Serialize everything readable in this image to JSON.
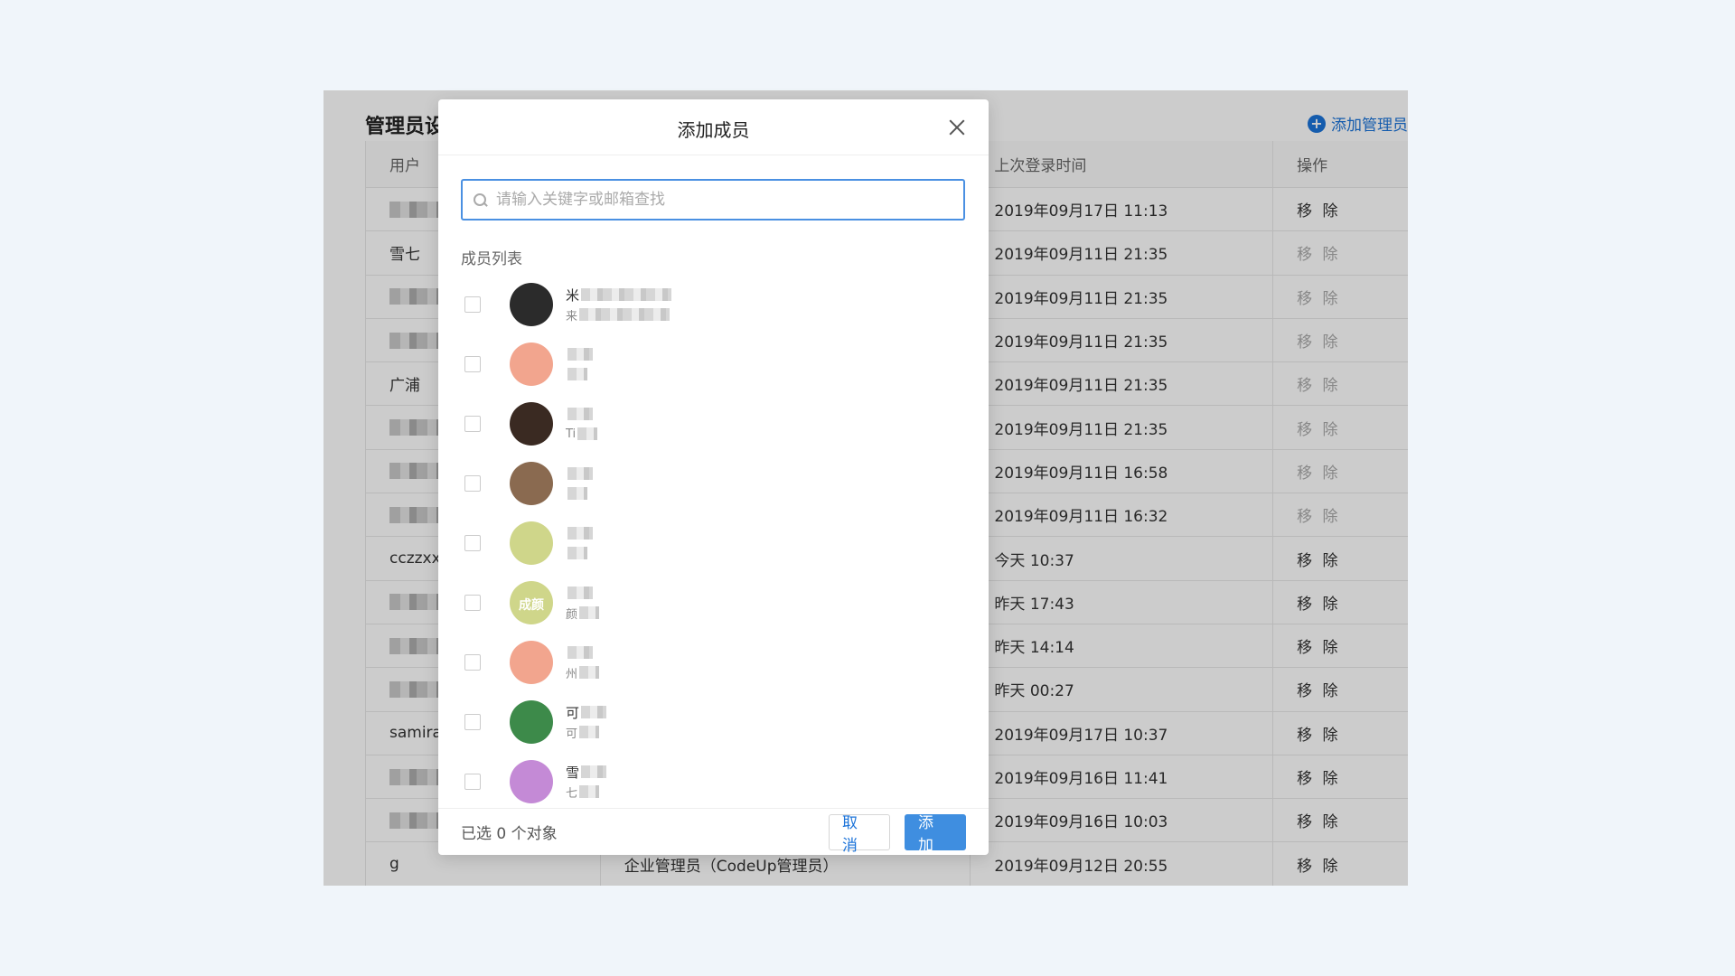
{
  "page": {
    "title": "管理员设",
    "add_admin_label": "添加管理员",
    "table": {
      "headers": {
        "user": "用户",
        "role": "",
        "last_login": "上次登录时间",
        "action": "操作"
      },
      "rows": [
        {
          "user": "",
          "role": "",
          "last_login": "2019年09月17日 11:13",
          "action": "移 除",
          "enabled": true
        },
        {
          "user": "雪七",
          "role": "",
          "last_login": "2019年09月11日 21:35",
          "action": "移 除",
          "enabled": false
        },
        {
          "user": "",
          "role": "",
          "last_login": "2019年09月11日 21:35",
          "action": "移 除",
          "enabled": false
        },
        {
          "user": "",
          "role": "",
          "last_login": "2019年09月11日 21:35",
          "action": "移 除",
          "enabled": false
        },
        {
          "user": "广浦",
          "role": "",
          "last_login": "2019年09月11日 21:35",
          "action": "移 除",
          "enabled": false
        },
        {
          "user": "",
          "role": "",
          "last_login": "2019年09月11日 21:35",
          "action": "移 除",
          "enabled": false
        },
        {
          "user": "",
          "role": "",
          "last_login": "2019年09月11日 16:58",
          "action": "移 除",
          "enabled": false
        },
        {
          "user": "",
          "role": "",
          "last_login": "2019年09月11日 16:32",
          "action": "移 除",
          "enabled": false
        },
        {
          "user": "cczzxx",
          "role": "",
          "last_login": "今天 10:37",
          "action": "移 除",
          "enabled": true
        },
        {
          "user": "",
          "role": "",
          "last_login": "昨天 17:43",
          "action": "移 除",
          "enabled": true
        },
        {
          "user": "",
          "role": "",
          "last_login": "昨天 14:14",
          "action": "移 除",
          "enabled": true
        },
        {
          "user": "",
          "role": "",
          "last_login": "昨天 00:27",
          "action": "移 除",
          "enabled": true
        },
        {
          "user": "samira",
          "role": "",
          "last_login": "2019年09月17日 10:37",
          "action": "移 除",
          "enabled": true
        },
        {
          "user": "",
          "role": "",
          "last_login": "2019年09月16日 11:41",
          "action": "移 除",
          "enabled": true
        },
        {
          "user": "",
          "role": "",
          "last_login": "2019年09月16日 10:03",
          "action": "移 除",
          "enabled": true
        },
        {
          "user": "g",
          "role": "企业管理员（CodeUp管理员）",
          "last_login": "2019年09月12日 20:55",
          "action": "移 除",
          "enabled": true
        }
      ]
    }
  },
  "modal": {
    "title": "添加成员",
    "search_placeholder": "请输入关键字或邮箱查找",
    "search_value": "",
    "list_label": "成员列表",
    "members": [
      {
        "name": "米",
        "sub": "来",
        "avatar_color": "#2b2b2b",
        "avatar_text": ""
      },
      {
        "name": "",
        "sub": "",
        "avatar_color": "#f2a58e",
        "avatar_text": ""
      },
      {
        "name": "",
        "sub": "Ti",
        "avatar_color": "#3a2a22",
        "avatar_text": ""
      },
      {
        "name": "",
        "sub": "",
        "avatar_color": "#8a6a50",
        "avatar_text": ""
      },
      {
        "name": "",
        "sub": "",
        "avatar_color": "#cfd68a",
        "avatar_text": ""
      },
      {
        "name": "",
        "sub": "颜",
        "avatar_color": "#cfd68a",
        "avatar_text": "成颜"
      },
      {
        "name": "",
        "sub": "州",
        "avatar_color": "#f2a58e",
        "avatar_text": ""
      },
      {
        "name": "可",
        "sub": "可",
        "avatar_color": "#3d8a4a",
        "avatar_text": ""
      },
      {
        "name": "雪",
        "sub": "七",
        "avatar_color": "#c48ad6",
        "avatar_text": ""
      }
    ],
    "selected_count": "已选 0 个对象",
    "cancel_label": "取 消",
    "add_label": "添 加"
  },
  "colors": {
    "accent": "#3f8ee0",
    "link": "#1b73d9",
    "overlay": "rgba(0,0,0,0.2)"
  }
}
